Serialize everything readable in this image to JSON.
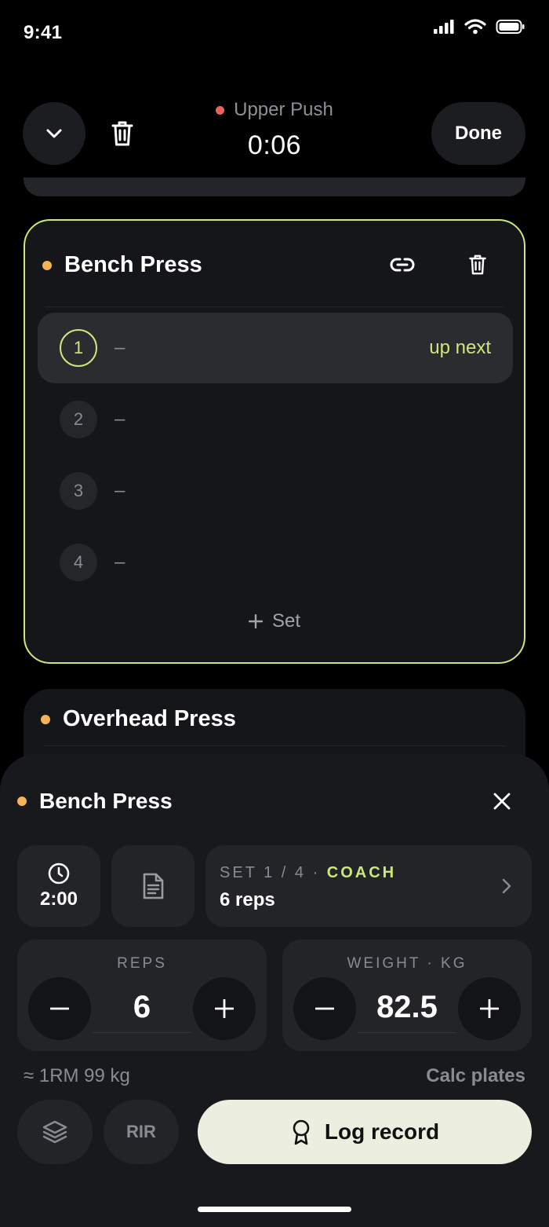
{
  "status_bar": {
    "time": "9:41"
  },
  "header": {
    "collapse_icon": "chevron-down-icon",
    "delete_icon": "trash-icon",
    "workout_name": "Upper Push",
    "elapsed": "0:06",
    "done_label": "Done",
    "recording_color": "#ef5f5b"
  },
  "current_exercise": {
    "name": "Bench Press",
    "dot_color": "#f4b455",
    "accent": "#cbe87c",
    "link_icon": "link-icon",
    "delete_icon": "trash-icon",
    "sets": [
      {
        "number": "1",
        "value": "–",
        "tag": "up next"
      },
      {
        "number": "2",
        "value": "–"
      },
      {
        "number": "3",
        "value": "–"
      },
      {
        "number": "4",
        "value": "–"
      }
    ],
    "add_set_label": "Set"
  },
  "next_exercise": {
    "name": "Overhead Press"
  },
  "sheet": {
    "title": "Bench Press",
    "rest_timer": "2:00",
    "set_info": "SET 1 / 4 · ",
    "coach_tag": "COACH",
    "target": "6 reps",
    "reps": {
      "label": "REPS",
      "value": "6"
    },
    "weight": {
      "label": "WEIGHT · KG",
      "value": "82.5"
    },
    "one_rm": "≈ 1RM 99 kg",
    "calc_plates": "Calc plates",
    "rir_label": "RIR",
    "log_label": "Log record"
  }
}
